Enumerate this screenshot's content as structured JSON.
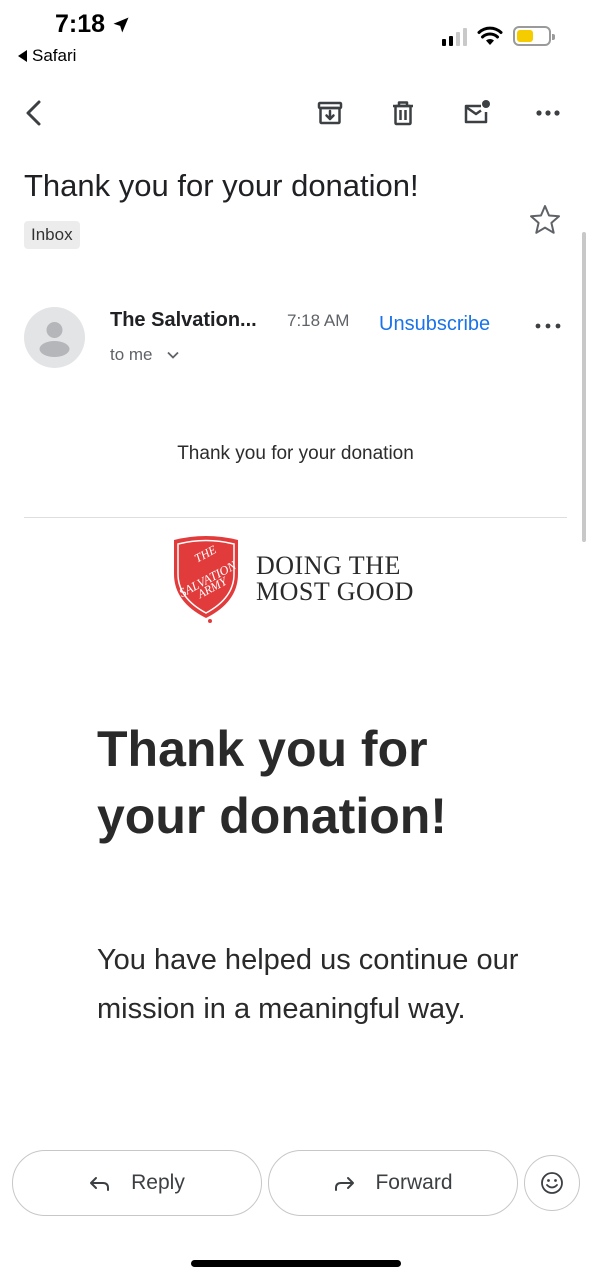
{
  "status_bar": {
    "time": "7:18",
    "back_app": "Safari",
    "battery_color": "#f5cc00",
    "icons": [
      "location-arrow-icon",
      "cellular-signal-icon",
      "wifi-icon",
      "battery-icon"
    ]
  },
  "toolbar": {
    "icons": [
      "back-arrow-icon",
      "archive-icon",
      "trash-icon",
      "mark-unread-icon",
      "more-horizontal-icon"
    ]
  },
  "email": {
    "subject": "Thank you for your donation!",
    "label": "Inbox",
    "sender": "The Salvation...",
    "time": "7:18 AM",
    "unsubscribe": "Unsubscribe",
    "recipient": "to me"
  },
  "content": {
    "preheader": "Thank you for your donation",
    "logo": {
      "shield_lines": [
        "THE",
        "SALVATION",
        "ARMY"
      ],
      "tagline_line1": "DOING THE",
      "tagline_line2": "MOST GOOD",
      "shield_color": "#e23b3b"
    },
    "heading": "Thank you for your donation!",
    "paragraph": "You have helped us continue our mission in a meaningful way."
  },
  "actions": {
    "reply": "Reply",
    "forward": "Forward"
  },
  "colors": {
    "link": "#1a73e8"
  }
}
